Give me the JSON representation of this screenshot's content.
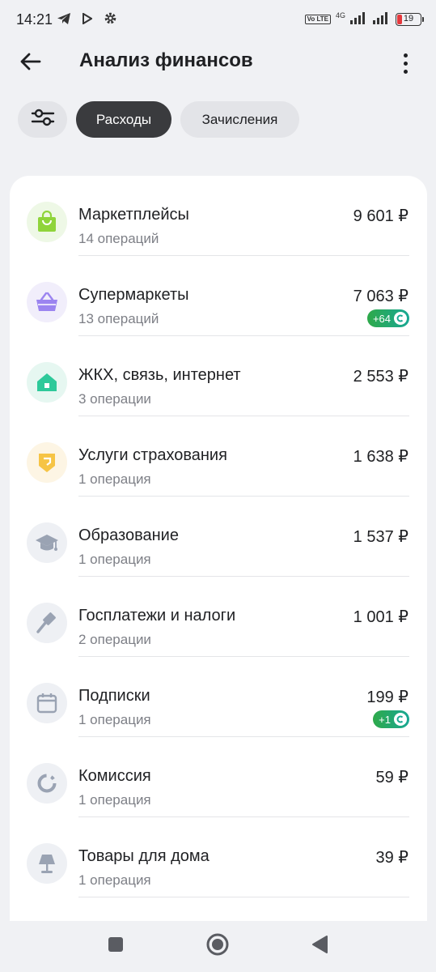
{
  "status_bar": {
    "time": "14:21",
    "volte": "Vo LTE",
    "network": "4G",
    "battery": "19",
    "battery_color": "#e5393d"
  },
  "header": {
    "title": "Анализ финансов",
    "back_icon": "arrow-left-icon",
    "menu_icon": "more-vertical-icon"
  },
  "filters": {
    "settings_icon": "sliders-icon",
    "tabs": [
      {
        "label": "Расходы",
        "active": true
      },
      {
        "label": "Зачисления",
        "active": false
      }
    ]
  },
  "categories": [
    {
      "name": "Маркетплейсы",
      "ops": "14 операций",
      "amount": "9 601 ₽",
      "icon": "shopping-bag-icon",
      "bg": "#eef8e6",
      "color": "#8fd43b"
    },
    {
      "name": "Супермаркеты",
      "ops": "13 операций",
      "amount": "7 063 ₽",
      "cashback": "+64",
      "icon": "basket-icon",
      "bg": "#f1eefb",
      "color": "#9b84f0"
    },
    {
      "name": "ЖКХ, связь, интернет",
      "ops": "3 операции",
      "amount": "2 553 ₽",
      "icon": "house-icon",
      "bg": "#e6f7f1",
      "color": "#2ec99a"
    },
    {
      "name": "Услуги страхования",
      "ops": "1 операция",
      "amount": "1 638 ₽",
      "icon": "shield-icon",
      "bg": "#fdf5e4",
      "color": "#f6c445"
    },
    {
      "name": "Образование",
      "ops": "1 операция",
      "amount": "1 537 ₽",
      "icon": "graduation-cap-icon",
      "bg": "#eef0f4",
      "color": "#9aa3b3"
    },
    {
      "name": "Госплатежи и налоги",
      "ops": "2 операции",
      "amount": "1 001 ₽",
      "icon": "gavel-icon",
      "bg": "#eef0f4",
      "color": "#9aa3b3"
    },
    {
      "name": "Подписки",
      "ops": "1 операция",
      "amount": "199 ₽",
      "cashback": "+1",
      "icon": "calendar-icon",
      "bg": "#eef0f4",
      "color": "#9aa3b3"
    },
    {
      "name": "Комиссия",
      "ops": "1 операция",
      "amount": "59 ₽",
      "icon": "percent-ring-icon",
      "bg": "#eef0f4",
      "color": "#9aa3b3"
    },
    {
      "name": "Товары для дома",
      "ops": "1 операция",
      "amount": "39 ₽",
      "icon": "lamp-icon",
      "bg": "#eef0f4",
      "color": "#9aa3b3"
    }
  ],
  "nav": {
    "recents_icon": "square-icon",
    "home_icon": "circle-icon",
    "back_icon": "triangle-back-icon"
  }
}
